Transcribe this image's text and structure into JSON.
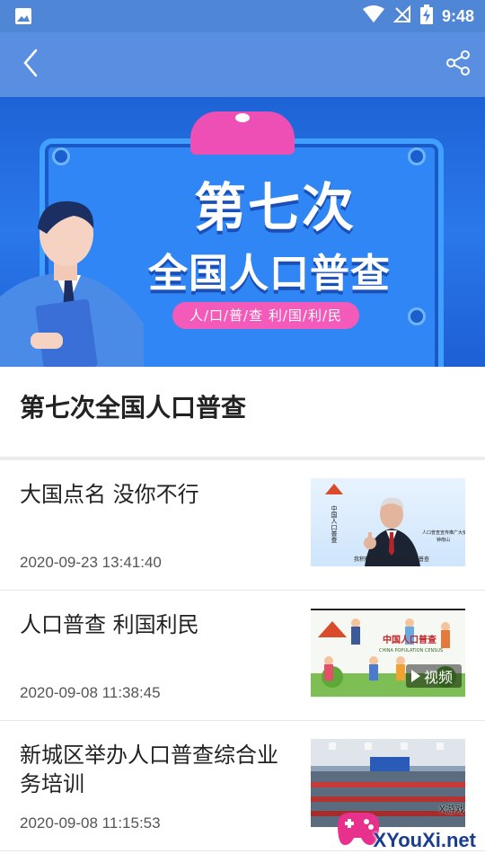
{
  "status_bar": {
    "time": "9:48"
  },
  "header": {
    "back_icon": "chevron-left-icon",
    "share_icon": "share-icon"
  },
  "banner": {
    "line1": "第七次",
    "line2": "全国人口普查",
    "slogan": "人/口/普/查  利/国/利/民"
  },
  "page_title": "第七次全国人口普查",
  "articles": [
    {
      "title": "大国点名 没你不行",
      "date": "2020-09-23 13:41:40",
      "thumb_caption": "我积极配合第七次全国人口普查",
      "thumb_side": "人口普查宣传推广大使\n钟南山",
      "thumb_logo_text": "中国人口普查"
    },
    {
      "title": "人口普查 利国利民",
      "date": "2020-09-08 11:38:45",
      "thumb_logo_text": "中国人口普查",
      "thumb_sub": "CHINA POPULATION CENSUS",
      "thumb_badge": "视频"
    },
    {
      "title": "新城区举办人口普查综合业务培训",
      "date": "2020-09-08 11:15:53"
    }
  ],
  "watermark": {
    "brand": "XYouXi.net",
    "small": "X游戏"
  },
  "colors": {
    "status_bar": "#4f86d6",
    "app_bar": "#5a8ee0",
    "banner_pink": "#f35ab9"
  }
}
